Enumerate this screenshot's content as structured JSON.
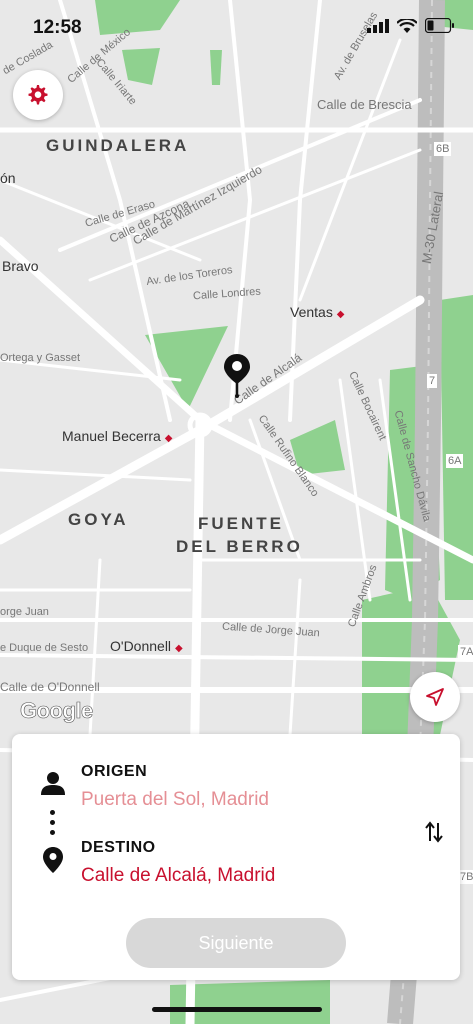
{
  "status_bar": {
    "time": "12:58"
  },
  "map": {
    "districts": [
      "GUINDALERA",
      "GOYA",
      "FUENTE",
      "DEL BERRO"
    ],
    "pois": [
      "Ventas",
      "Manuel Becerra",
      "O'Donnell",
      "Bravo",
      "ón"
    ],
    "streets": [
      "Calle de Brescia",
      "Calle de Eraso",
      "Calle de Azcona",
      "Calle de Martínez Izquierdo",
      "Av. de los Toreros",
      "Calle Londres",
      "Calle de Alcalá",
      "Calle Bocairent",
      "Calle Rufino Blanco",
      "Calle de Sancho Dávila",
      "Calle Ambros",
      "Calle de Jorge Juan",
      "orge Juan",
      "e Duque de Sesto",
      "Calle de O'Donnell",
      "Ortega y Gasset",
      "M-30 Lateral",
      "Av. de Bruselas",
      "Calle Iriarte",
      "de Coslada",
      "Calle de México"
    ],
    "exits": [
      "6B",
      "7",
      "6A",
      "7A",
      "7B"
    ],
    "colors": {
      "background": "#e8e8e8",
      "road": "#ffffff",
      "park": "#8fd18f",
      "highway": "#bdbdbd"
    }
  },
  "attribution": "Google",
  "buttons": {
    "settings_icon": "gear-icon",
    "locate_icon": "navigation-arrow-icon"
  },
  "route_panel": {
    "origin_label": "ORIGEN",
    "origin_value": "Puerta del Sol, Madrid",
    "destination_label": "DESTINO",
    "destination_value": "Calle de Alcalá, Madrid",
    "next_label": "Siguiente",
    "swap_icon": "swap-vertical-icon",
    "colors": {
      "accent": "#c8102e",
      "origin_text": "#e58f95",
      "button_disabled": "#d8d8d8"
    }
  }
}
